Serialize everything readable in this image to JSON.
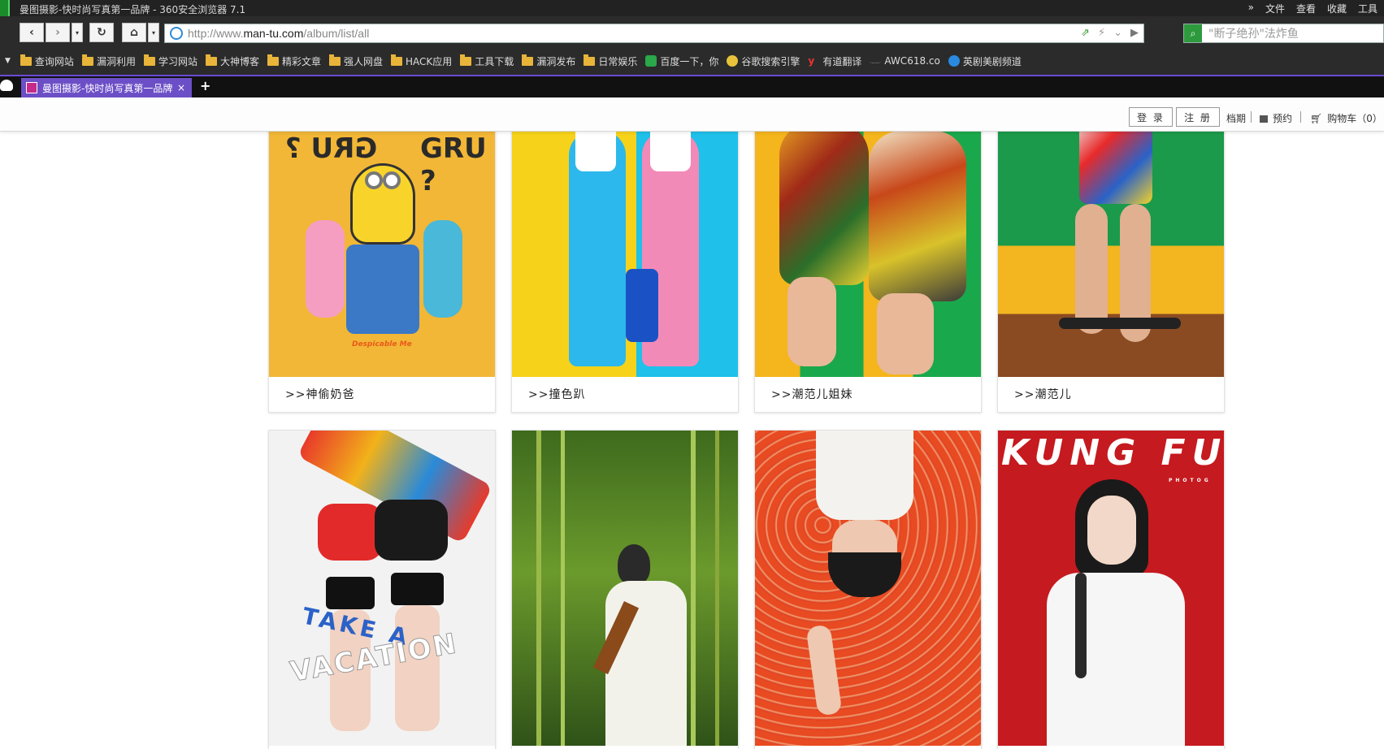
{
  "browser": {
    "window_title": "曼图摄影-快时尚写真第一品牌 - 360安全浏览器 7.1",
    "menu": [
      "»",
      "文件",
      "查看",
      "收藏",
      "工具"
    ],
    "url_prefix": "http://www.",
    "url_domain": "man-tu.com",
    "url_path": "/album/list/all",
    "search_placeholder": "\"断子绝孙\"法炸鱼",
    "bookmarks": [
      {
        "label": "查询网站",
        "icon": "folder-icon"
      },
      {
        "label": "漏洞利用",
        "icon": "folder-icon"
      },
      {
        "label": "学习网站",
        "icon": "folder-icon"
      },
      {
        "label": "大神博客",
        "icon": "folder-icon"
      },
      {
        "label": "精彩文章",
        "icon": "folder-icon"
      },
      {
        "label": "强人网盘",
        "icon": "folder-icon"
      },
      {
        "label": "HACK应用",
        "icon": "folder-icon"
      },
      {
        "label": "工具下载",
        "icon": "folder-icon"
      },
      {
        "label": "漏洞发布",
        "icon": "folder-icon"
      },
      {
        "label": "日常娱乐",
        "icon": "folder-icon"
      },
      {
        "label": "百度一下，你",
        "icon": "baidu-icon"
      },
      {
        "label": "谷歌搜索引擎",
        "icon": "google-icon"
      },
      {
        "label": "有道翻译",
        "icon": "youdao-icon"
      },
      {
        "label": "AWC618.co",
        "icon": "link-icon"
      },
      {
        "label": "英剧美剧频道",
        "icon": "play-icon"
      }
    ],
    "tab_title": "曼图摄影-快时尚写真第一品牌",
    "tab_close": "×",
    "new_tab": "+",
    "colors": {
      "tab_active": "#6c4fc7",
      "chrome": "#2b2b2b"
    }
  },
  "site_header": {
    "login": "登 录",
    "register": "注 册",
    "schedule": "档期",
    "booking": "预约",
    "cart": "购物车（0）"
  },
  "albums": [
    {
      "caption": ">>神偷奶爸",
      "poster_top": "GRU ?",
      "poster_bottom": "Despicable Me"
    },
    {
      "caption": ">>撞色趴"
    },
    {
      "caption": ">>潮范儿姐妹"
    },
    {
      "caption": ">>潮范儿"
    },
    {
      "caption": "",
      "poster_text_1": "TAKE A",
      "poster_text_2": "VACATION"
    },
    {
      "caption": ""
    },
    {
      "caption": ""
    },
    {
      "caption": "",
      "poster_text_1": "KUNG FU",
      "poster_subtext": "PHOTOG"
    }
  ]
}
